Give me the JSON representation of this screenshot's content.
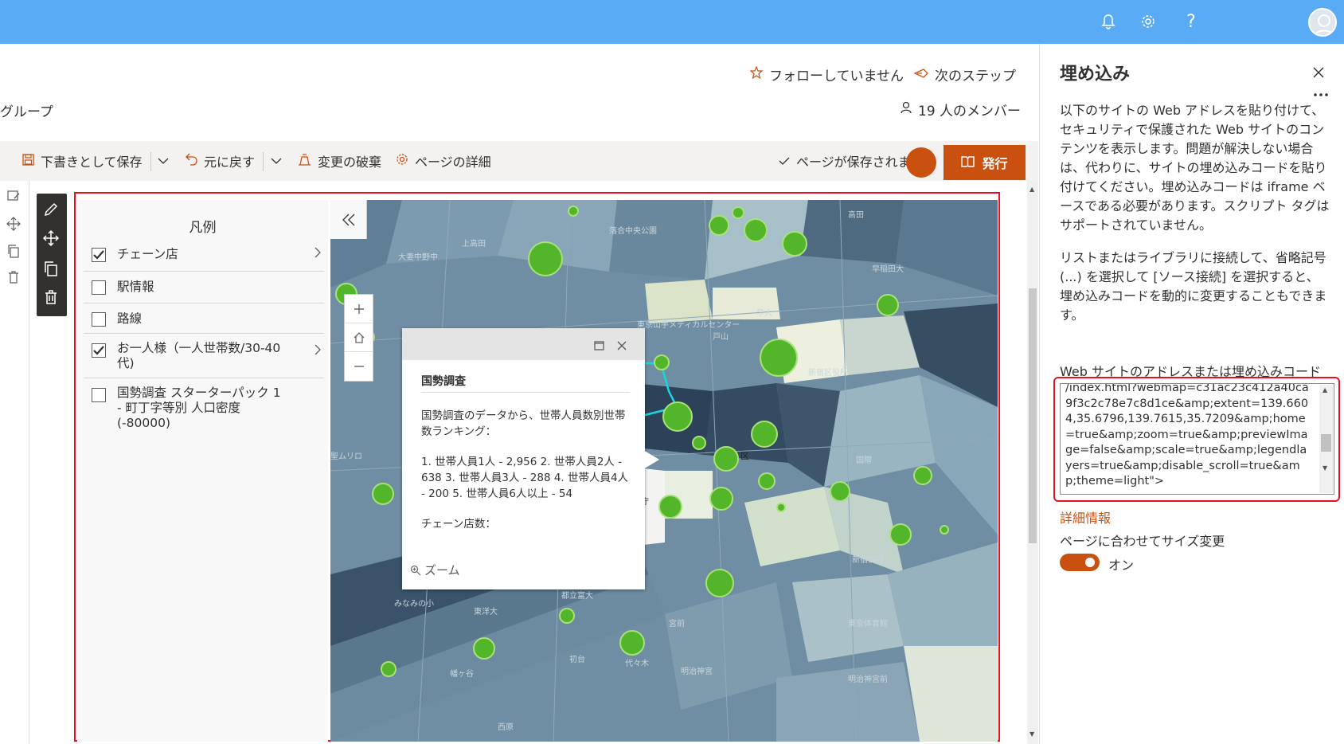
{
  "topbar": {
    "icons": [
      "bell-icon",
      "gear-icon",
      "help-icon",
      "avatar"
    ],
    "help_glyph": "?"
  },
  "header": {
    "follow_label": "フォローしていません",
    "next_steps_label": "次のステップ",
    "group_label": "グループ",
    "members_label": "19 人のメンバー"
  },
  "toolbar": {
    "save_draft_label": "下書きとして保存",
    "undo_label": "元に戻す",
    "discard_label": "変更の破棄",
    "page_details_label": "ページの詳細",
    "saved_status": "ページが保存されま",
    "publish_label": "発行"
  },
  "legend": {
    "title": "凡例",
    "items": [
      {
        "label": "チェーン店",
        "checked": true,
        "expandable": true
      },
      {
        "label": "駅情報",
        "checked": false,
        "expandable": false
      },
      {
        "label": "路線",
        "checked": false,
        "expandable": false
      },
      {
        "label": "お一人様（一人世帯数/30-40代)",
        "checked": true,
        "expandable": true
      },
      {
        "label": "国勢調査 スターターパック 1 - 町丁字等別 人口密度 (-80000)",
        "checked": false,
        "expandable": false
      }
    ]
  },
  "map": {
    "labels": [
      "上高田",
      "大妻中野中",
      "高田",
      "早稲田大",
      "落合中央公園",
      "早大",
      "戸山",
      "東京山手メディカルセンター",
      "新宿",
      "都庁",
      "区",
      "渋谷本町",
      "代々木",
      "初台",
      "西原",
      "幡ヶ谷",
      "明治神宮",
      "新宿御苑",
      "みなみの小",
      "東京体育館",
      "宮前",
      "国際",
      "都立富大",
      "東洋大",
      "聖ムリロ",
      "新宿区役所",
      "明治神宮前"
    ],
    "popup": {
      "title": "国勢調査",
      "intro": "国勢調査のデータから、世帯人員数別世帯数ランキング：",
      "ranking": "1. 世帯人員1人 - 2,956 2. 世帯人員2人 - 638 3. 世帯人員3人 - 288 4. 世帯人員4人 - 200 5. 世帯人員6人以上 - 54",
      "chain_label": "チェーン店数：",
      "zoom_label": "ズーム"
    }
  },
  "panel": {
    "title": "埋め込み",
    "description": "以下のサイトの Web アドレスを貼り付けて、セキュリティで保護された Web サイトのコンテンツを表示します。問題が解決しない場合は、代わりに、サイトの埋め込みコードを貼り付けてください。埋め込みコードは iframe ベースである必要があります。スクリプト タグはサポートされていません。",
    "description2": "リストまたはライブラリに接続して、省略記号 (...) を選択して [ソース接続] を選択すると、埋め込みコードを動的に変更することもできます。",
    "code_label": "Web サイトのアドレスまたは埋め込みコード",
    "code_value": "/index.html?webmap=c31ac23c412a40ca9f3c2c78e7c8d1ce&amp;extent=139.6604,35.6796,139.7615,35.7209&amp;home=true&amp;zoom=true&amp;previewImage=false&amp;scale=true&amp;legendlayers=true&amp;disable_scroll=true&amp;theme=light\">",
    "more_info_label": "詳細情報",
    "resize_label": "ページに合わせてサイズ変更",
    "toggle_state": "オン",
    "toggle_on": true
  },
  "colors": {
    "suite_bar": "#5aabf5",
    "accent": "#ca5010",
    "highlight_border": "#e81123",
    "map_dot": "#52b52a"
  }
}
